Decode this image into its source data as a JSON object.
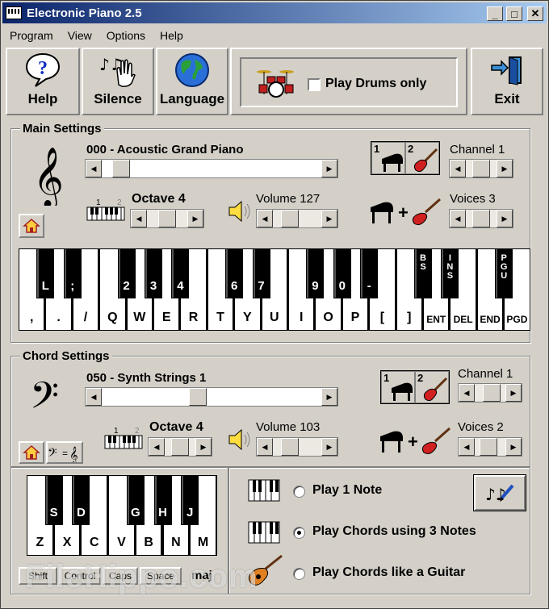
{
  "window": {
    "title": "Electronic Piano 2.5",
    "minimize": "_",
    "maximize": "□",
    "close": "✕"
  },
  "menu": [
    "Program",
    "View",
    "Options",
    "Help"
  ],
  "toolbar": {
    "help": "Help",
    "silence": "Silence",
    "language": "Language",
    "drums_only": "Play Drums only",
    "exit": "Exit"
  },
  "main": {
    "title": "Main Settings",
    "instrument": "000 - Acoustic Grand Piano",
    "instrument_level": 0.05,
    "octave": "Octave 4",
    "octave_level": 0.5,
    "volume": "Volume 127",
    "volume_level": 0.25,
    "channel": "Channel 1",
    "channel_level": 0.5,
    "voices": "Voices 3",
    "voices_level": 0.5,
    "inst_num_1": "1",
    "inst_num_2": "2",
    "oct_num_1": "1",
    "oct_num_2": "2"
  },
  "main_keys": {
    "white": [
      ",",
      ".",
      "/",
      "Q",
      "W",
      "E",
      "R",
      "T",
      "Y",
      "U",
      "I",
      "O",
      "P",
      "[",
      "]",
      "ENT",
      "DEL",
      "END",
      "PGD"
    ],
    "black": [
      {
        "label": "L",
        "after": 0
      },
      {
        "label": ";",
        "after": 1
      },
      {
        "label": "2",
        "after": 3
      },
      {
        "label": "3",
        "after": 4
      },
      {
        "label": "4",
        "after": 5
      },
      {
        "label": "6",
        "after": 7
      },
      {
        "label": "7",
        "after": 8
      },
      {
        "label": "9",
        "after": 10
      },
      {
        "label": "0",
        "after": 11
      },
      {
        "label": "-",
        "after": 12
      },
      {
        "label": "BS",
        "after": 14,
        "vertical": true
      },
      {
        "label": "INS",
        "after": 15,
        "vertical": true
      },
      {
        "label": "PGU",
        "after": 17,
        "vertical": true
      }
    ]
  },
  "chord": {
    "title": "Chord Settings",
    "instrument": "050 - Synth Strings 1",
    "instrument_level": 0.43,
    "octave": "Octave 4",
    "octave_level": 0.5,
    "volume": "Volume 103",
    "volume_level": 0.25,
    "channel": "Channel 1",
    "channel_level": 0.6,
    "voices": "Voices 2",
    "voices_level": 0.4,
    "inst_num_1": "1",
    "inst_num_2": "2",
    "oct_num_1": "1",
    "oct_num_2": "2"
  },
  "chord_keys": {
    "white": [
      "Z",
      "X",
      "C",
      "V",
      "B",
      "N",
      "M"
    ],
    "black": [
      {
        "label": "S",
        "after": 0
      },
      {
        "label": "D",
        "after": 1
      },
      {
        "label": "G",
        "after": 3
      },
      {
        "label": "H",
        "after": 4
      },
      {
        "label": "J",
        "after": 5
      }
    ],
    "modifiers": [
      "Shift",
      "Control",
      "Caps",
      "Space"
    ],
    "maj": "maj"
  },
  "modes": [
    {
      "label": "Play 1 Note",
      "selected": false
    },
    {
      "label": "Play Chords using 3 Notes",
      "selected": true
    },
    {
      "label": "Play Chords like a Guitar",
      "selected": false
    }
  ],
  "watermark": "FileHippo.com"
}
